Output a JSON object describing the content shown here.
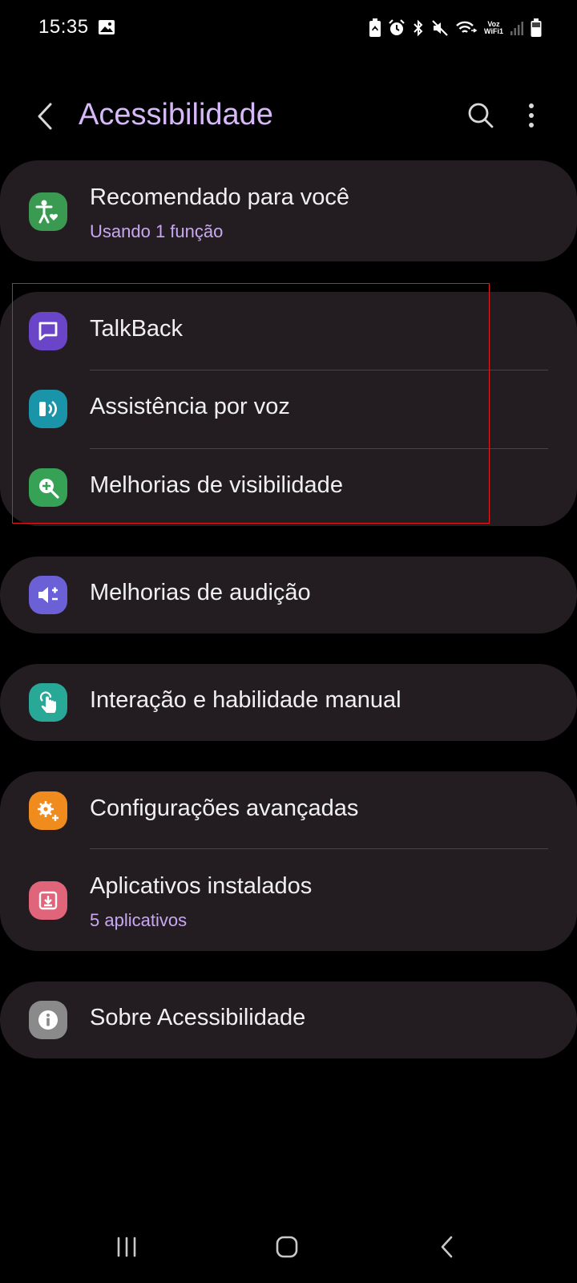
{
  "status_bar": {
    "time": "15:35",
    "icons": [
      "gallery-icon",
      "battery-saver-icon",
      "alarm-icon",
      "bluetooth-icon",
      "mute-icon",
      "wifi-calling-icon",
      "signal-icon",
      "battery-icon"
    ],
    "voz_top": "Voz",
    "voz_bottom": "WiFi1"
  },
  "header": {
    "title": "Acessibilidade",
    "back_icon": "chevron-left-icon",
    "search_icon": "search-icon",
    "more_icon": "more-vertical-icon"
  },
  "sections": [
    {
      "items": [
        {
          "title": "Recomendado para você",
          "subtitle": "Usando 1 função",
          "icon": "accessibility-person-icon",
          "color": "#3a9a52"
        }
      ]
    },
    {
      "items": [
        {
          "title": "TalkBack",
          "icon": "talkback-chat-icon",
          "color": "#6a45c8"
        },
        {
          "title": "Assistência por voz",
          "icon": "voice-assistant-icon",
          "color": "#1a94a8"
        },
        {
          "title": "Melhorias de visibilidade",
          "icon": "zoom-in-icon",
          "color": "#36a255"
        }
      ]
    },
    {
      "items": [
        {
          "title": "Melhorias de audição",
          "icon": "hearing-volume-icon",
          "color": "#6b60d6"
        }
      ]
    },
    {
      "items": [
        {
          "title": "Interação e habilidade manual",
          "icon": "touch-hand-icon",
          "color": "#28a897"
        }
      ]
    },
    {
      "items": [
        {
          "title": "Configurações avançadas",
          "icon": "advanced-gears-icon",
          "color": "#f08c1e"
        },
        {
          "title": "Aplicativos instalados",
          "subtitle": "5 aplicativos",
          "icon": "installed-apps-download-icon",
          "color": "#e0647a"
        }
      ]
    },
    {
      "items": [
        {
          "title": "Sobre Acessibilidade",
          "icon": "info-icon",
          "color": "#8a8a8a"
        }
      ]
    }
  ],
  "nav_bar": {
    "recent_icon": "recent-apps-icon",
    "home_icon": "home-icon",
    "back_icon": "back-icon"
  },
  "colors": {
    "background": "#000000",
    "card": "#231d22",
    "title_accent": "#d6b9f8",
    "subtitle_accent": "#c9a8f2",
    "highlight_border": "#e0191c"
  }
}
